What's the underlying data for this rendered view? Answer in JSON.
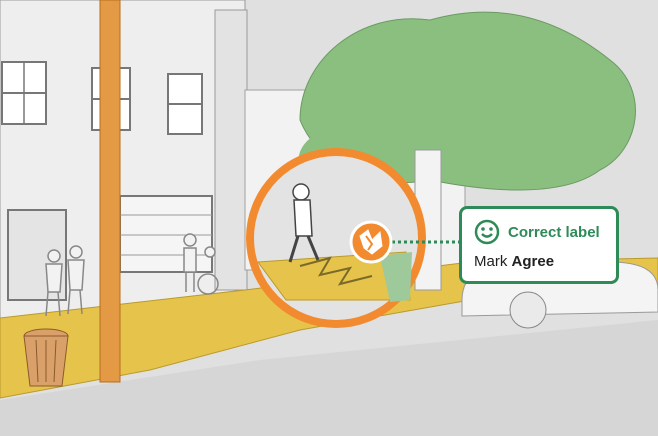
{
  "colors": {
    "accent": "#2e8b57",
    "ring": "#f28a30",
    "sidewalk": "#e8c64a",
    "tree": "#8bbf7f",
    "building": "#e7e7e7",
    "road": "#d9d9d9"
  },
  "icons": {
    "marker": "crack-hazard-icon",
    "feedback": "smile-icon"
  },
  "feedback": {
    "title": "Correct label",
    "prefix": "Mark",
    "value": "Agree"
  }
}
